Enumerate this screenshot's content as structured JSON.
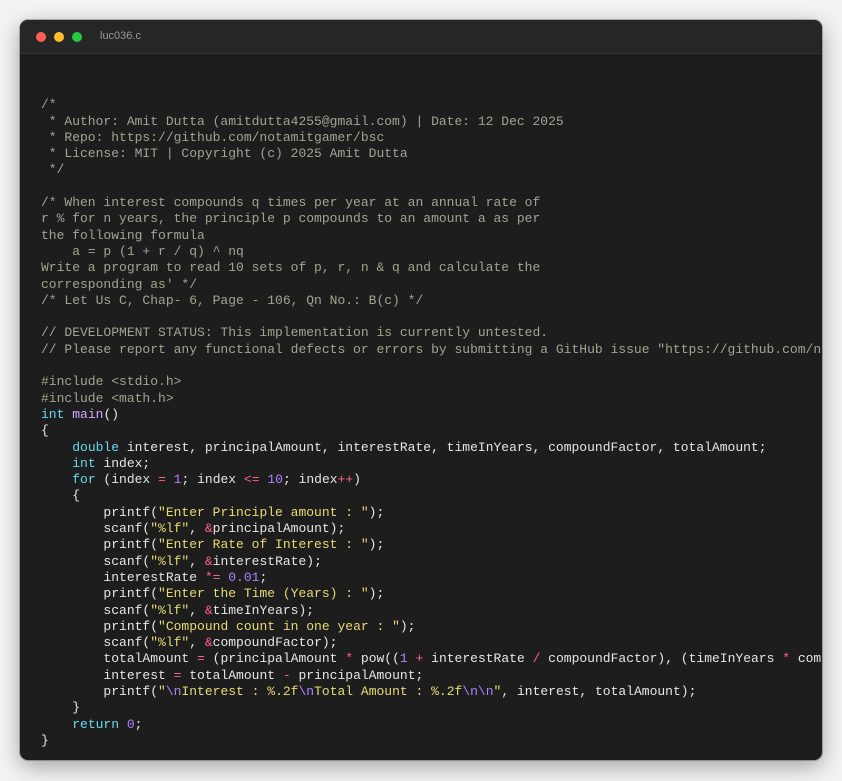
{
  "window": {
    "title": "luc036.c",
    "controls": [
      "close",
      "minimize",
      "maximize"
    ],
    "colors": {
      "close": "#ff5f57",
      "minimize": "#febc2e",
      "maximize": "#28c840",
      "background": "#1d1d1d"
    }
  },
  "code": {
    "lines": [
      [],
      [
        [
          "comment",
          "/*"
        ]
      ],
      [
        [
          "comment",
          " * Author: Amit Dutta (amitdutta4255@gmail.com) | Date: 12 Dec 2025"
        ]
      ],
      [
        [
          "comment",
          " * Repo: https://github.com/notamitgamer/bsc"
        ]
      ],
      [
        [
          "comment",
          " * License: MIT | Copyright (c) 2025 Amit Dutta"
        ]
      ],
      [
        [
          "comment",
          " */"
        ]
      ],
      [],
      [
        [
          "comment",
          "/* When interest compounds q times per year at an annual rate of"
        ]
      ],
      [
        [
          "comment",
          "r % for n years, the principle p compounds to an amount a as per"
        ]
      ],
      [
        [
          "comment",
          "the following formula"
        ]
      ],
      [
        [
          "comment",
          "    a = p (1 + r / q) ^ nq"
        ]
      ],
      [
        [
          "comment",
          "Write a program to read 10 sets of p, r, n & q and calculate the"
        ]
      ],
      [
        [
          "comment",
          "corresponding as' */"
        ]
      ],
      [
        [
          "comment",
          "/* Let Us C, Chap- 6, Page - 106, Qn No.: B(c) */"
        ]
      ],
      [],
      [
        [
          "comment",
          "// DEVELOPMENT STATUS: This implementation is currently untested."
        ]
      ],
      [
        [
          "comment",
          "// Please report any functional defects or errors by submitting a GitHub issue \"https://github.com/notamitgamer/bsc/issues\""
        ]
      ],
      [],
      [
        [
          "pre",
          "#include <stdio.h>"
        ]
      ],
      [
        [
          "pre",
          "#include <math.h>"
        ]
      ],
      [
        [
          "kw",
          "int"
        ],
        [
          "plain",
          " "
        ],
        [
          "fn",
          "main"
        ],
        [
          "plain",
          "()"
        ]
      ],
      [
        [
          "plain",
          "{"
        ]
      ],
      [
        [
          "plain",
          "    "
        ],
        [
          "kw",
          "double"
        ],
        [
          "plain",
          " interest, principalAmount, interestRate, timeInYears, compoundFactor, totalAmount;"
        ]
      ],
      [
        [
          "plain",
          "    "
        ],
        [
          "kw",
          "int"
        ],
        [
          "plain",
          " index;"
        ]
      ],
      [
        [
          "plain",
          "    "
        ],
        [
          "kw",
          "for"
        ],
        [
          "plain",
          " (index "
        ],
        [
          "op",
          "="
        ],
        [
          "plain",
          " "
        ],
        [
          "num",
          "1"
        ],
        [
          "plain",
          "; index "
        ],
        [
          "op",
          "<="
        ],
        [
          "plain",
          " "
        ],
        [
          "num",
          "10"
        ],
        [
          "plain",
          "; index"
        ],
        [
          "op",
          "++"
        ],
        [
          "plain",
          ")"
        ]
      ],
      [
        [
          "plain",
          "    {"
        ]
      ],
      [
        [
          "plain",
          "        printf("
        ],
        [
          "str",
          "\"Enter Principle amount : \""
        ],
        [
          "plain",
          ");"
        ]
      ],
      [
        [
          "plain",
          "        scanf("
        ],
        [
          "str",
          "\"%lf\""
        ],
        [
          "plain",
          ", "
        ],
        [
          "amp",
          "&"
        ],
        [
          "plain",
          "principalAmount);"
        ]
      ],
      [
        [
          "plain",
          "        printf("
        ],
        [
          "str",
          "\"Enter Rate of Interest : \""
        ],
        [
          "plain",
          ");"
        ]
      ],
      [
        [
          "plain",
          "        scanf("
        ],
        [
          "str",
          "\"%lf\""
        ],
        [
          "plain",
          ", "
        ],
        [
          "amp",
          "&"
        ],
        [
          "plain",
          "interestRate);"
        ]
      ],
      [
        [
          "plain",
          "        interestRate "
        ],
        [
          "op",
          "*="
        ],
        [
          "plain",
          " "
        ],
        [
          "num",
          "0.01"
        ],
        [
          "plain",
          ";"
        ]
      ],
      [
        [
          "plain",
          "        printf("
        ],
        [
          "str",
          "\"Enter the Time (Years) : \""
        ],
        [
          "plain",
          ");"
        ]
      ],
      [
        [
          "plain",
          "        scanf("
        ],
        [
          "str",
          "\"%lf\""
        ],
        [
          "plain",
          ", "
        ],
        [
          "amp",
          "&"
        ],
        [
          "plain",
          "timeInYears);"
        ]
      ],
      [
        [
          "plain",
          "        printf("
        ],
        [
          "str",
          "\"Compound count in one year : \""
        ],
        [
          "plain",
          ");"
        ]
      ],
      [
        [
          "plain",
          "        scanf("
        ],
        [
          "str",
          "\"%lf\""
        ],
        [
          "plain",
          ", "
        ],
        [
          "amp",
          "&"
        ],
        [
          "plain",
          "compoundFactor);"
        ]
      ],
      [
        [
          "plain",
          "        totalAmount "
        ],
        [
          "op",
          "="
        ],
        [
          "plain",
          " (principalAmount "
        ],
        [
          "op",
          "*"
        ],
        [
          "plain",
          " pow(("
        ],
        [
          "num",
          "1"
        ],
        [
          "plain",
          " "
        ],
        [
          "op",
          "+"
        ],
        [
          "plain",
          " interestRate "
        ],
        [
          "op",
          "/"
        ],
        [
          "plain",
          " compoundFactor), (timeInYears "
        ],
        [
          "op",
          "*"
        ],
        [
          "plain",
          " compoundFactor)));"
        ]
      ],
      [
        [
          "plain",
          "        interest "
        ],
        [
          "op",
          "="
        ],
        [
          "plain",
          " totalAmount "
        ],
        [
          "op",
          "-"
        ],
        [
          "plain",
          " principalAmount;"
        ]
      ],
      [
        [
          "plain",
          "        printf("
        ],
        [
          "str",
          "\""
        ],
        [
          "esc",
          "\\n"
        ],
        [
          "str",
          "Interest : %.2f"
        ],
        [
          "esc",
          "\\n"
        ],
        [
          "str",
          "Total Amount : %.2f"
        ],
        [
          "esc",
          "\\n\\n"
        ],
        [
          "str",
          "\""
        ],
        [
          "plain",
          ", interest, totalAmount);"
        ]
      ],
      [
        [
          "plain",
          "    }"
        ]
      ],
      [
        [
          "plain",
          "    "
        ],
        [
          "kw",
          "return"
        ],
        [
          "plain",
          " "
        ],
        [
          "num",
          "0"
        ],
        [
          "plain",
          ";"
        ]
      ],
      [
        [
          "plain",
          "}"
        ]
      ]
    ]
  }
}
